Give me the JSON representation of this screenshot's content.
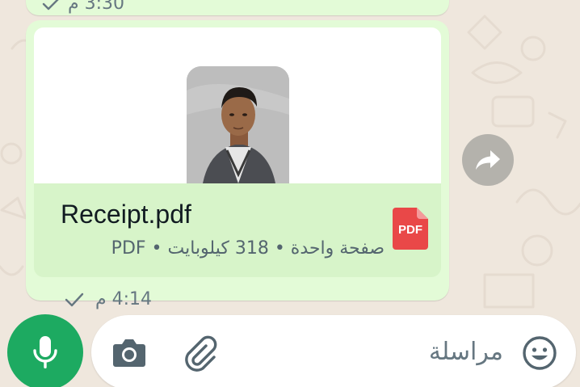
{
  "previous_message": {
    "time": "3:30 م",
    "status_icon": "check-icon"
  },
  "document_message": {
    "file_name": "Receipt.pdf",
    "file_info": "صفحة واحدة • 318 كيلوبايت • PDF",
    "file_type_badge": "PDF",
    "time": "4:14 م",
    "status_icon": "check-icon"
  },
  "composer": {
    "placeholder": "مراسلة"
  },
  "colors": {
    "bubble": "#e3fbd7",
    "doc_panel": "#d7f4c9",
    "accent_green": "#1daa61",
    "pdf_red": "#e94848"
  }
}
